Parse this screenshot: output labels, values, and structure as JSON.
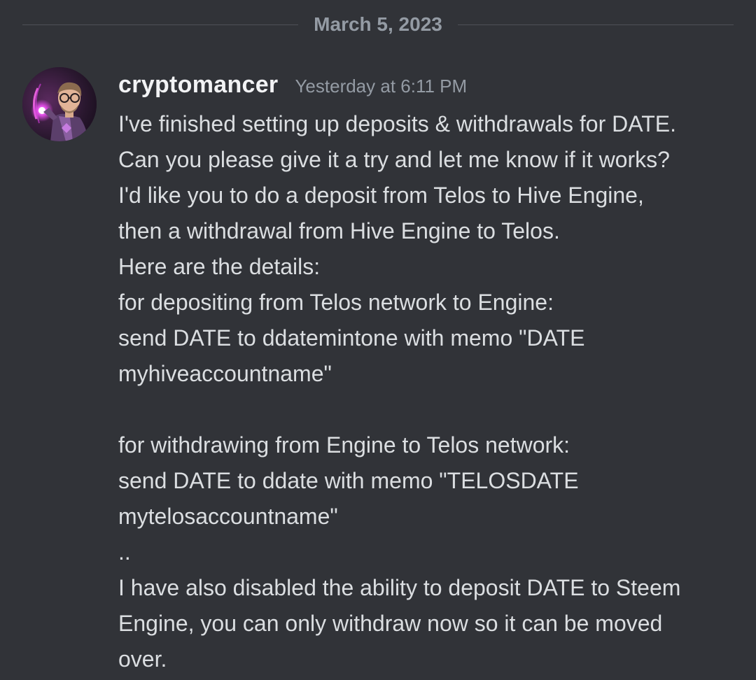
{
  "divider": {
    "date": "March 5, 2023"
  },
  "message": {
    "author": "cryptomancer",
    "timestamp": "Yesterday at 6:11 PM",
    "avatar_icon": "user-avatar",
    "lines": [
      "I've finished setting up deposits & withdrawals for DATE.",
      "Can you please give it a try and let me know if it works?",
      "I'd like you to do a deposit from Telos to Hive Engine,",
      "then a withdrawal from Hive Engine to Telos.",
      "Here are the details:",
      "for depositing from Telos network to Engine:",
      "send DATE to ddatemintone with memo \"DATE",
      "myhiveaccountname\"",
      "",
      "for withdrawing from Engine to Telos network:",
      "send DATE to ddate with memo \"TELOSDATE",
      "mytelosaccountname\"",
      "..",
      "I have also disabled the ability to deposit DATE to Steem",
      "Engine, you can only withdraw now so it can be moved",
      "over."
    ]
  },
  "colors": {
    "background": "#313338",
    "text": "#dbdee1",
    "muted": "#949ba4",
    "username": "#f2f3f5"
  }
}
